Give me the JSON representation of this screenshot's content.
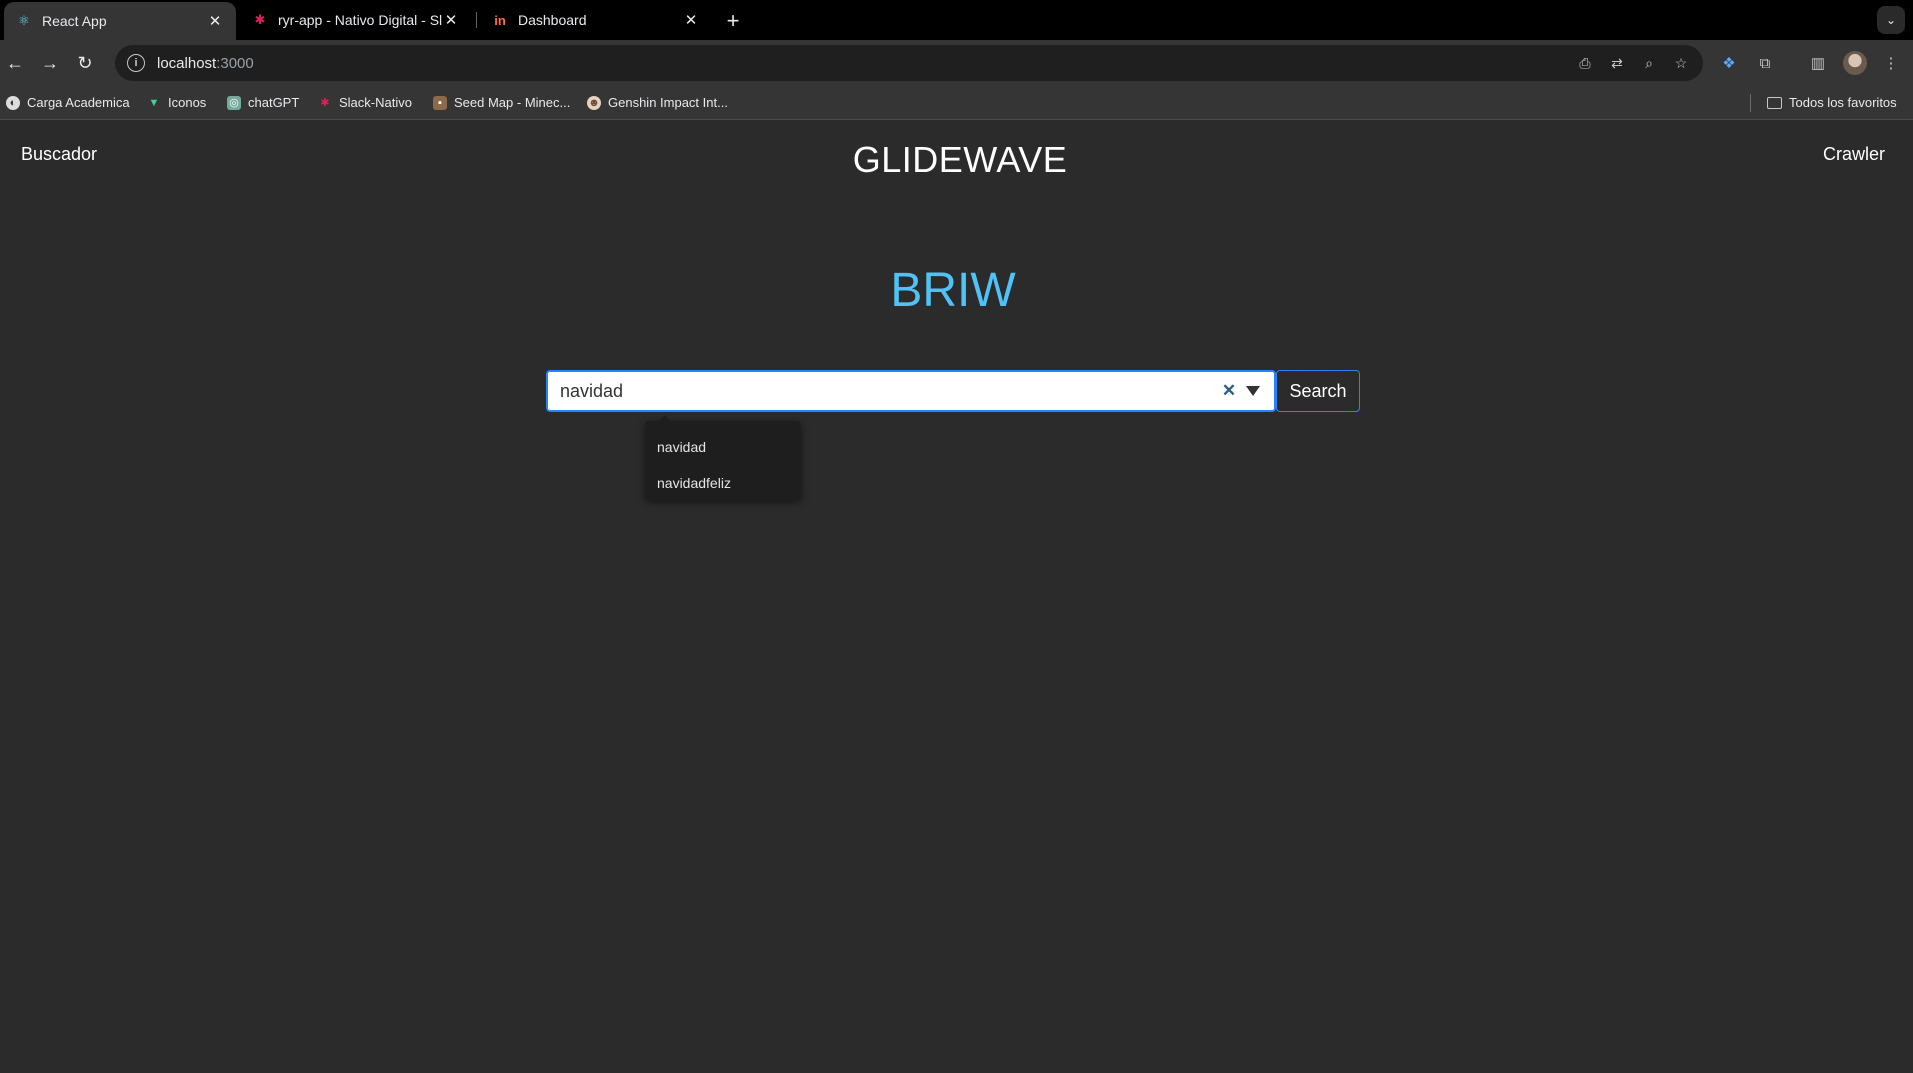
{
  "tabs": [
    {
      "title": "React App",
      "icon": "react-icon",
      "active": true
    },
    {
      "title": "ryr-app - Nativo Digital - Slac",
      "icon": "slack-icon",
      "active": false
    },
    {
      "title": "Dashboard",
      "icon": "invision-icon",
      "active": false
    }
  ],
  "address": {
    "host": "localhost",
    "port": ":3000"
  },
  "bookmarks": [
    {
      "label": "Carga Academica"
    },
    {
      "label": "Iconos"
    },
    {
      "label": "chatGPT"
    },
    {
      "label": "Slack-Nativo"
    },
    {
      "label": "Seed Map - Minec..."
    },
    {
      "label": "Genshin Impact Int..."
    }
  ],
  "bookmarks_folder": "Todos los favoritos",
  "app": {
    "nav_left": "Buscador",
    "brand": "GLIDEWAVE",
    "nav_right": "Crawler",
    "heading": "BRIW"
  },
  "search": {
    "value": "navidad",
    "button_label": "Search",
    "suggestions": [
      "navidad",
      "navidadfeliz"
    ]
  },
  "colors": {
    "accent": "#4fc3f7",
    "focus_border": "#2684ff",
    "page_bg": "#2b2b2b"
  }
}
